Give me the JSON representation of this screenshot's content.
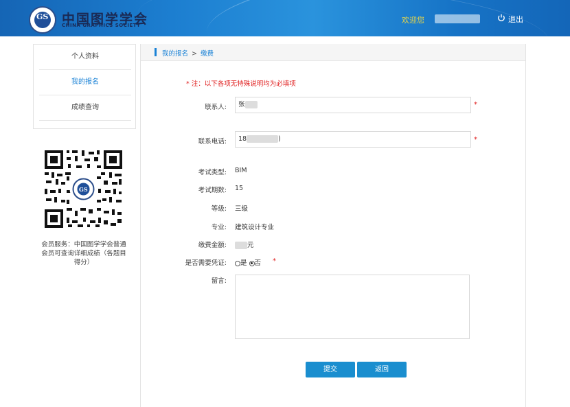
{
  "header": {
    "logo_cn": "中国图学学会",
    "logo_en": "CHINA GRAPHICS SOCIETY",
    "welcome": "欢迎您",
    "logout": "退出"
  },
  "sidebar": {
    "items": [
      {
        "label": "个人资料"
      },
      {
        "label": "我的报名"
      },
      {
        "label": "成绩查询"
      }
    ],
    "qr_caption": "会员服务：中国图学学会普通会员可查询详细成绩（各题目得分）"
  },
  "breadcrumb": {
    "parent": "我的报名",
    "separator": ">",
    "current": "缴费"
  },
  "form": {
    "note": "* 注：以下各项无特殊说明均为必填项",
    "contact_label": "联系人:",
    "contact_value": "张",
    "phone_label": "联系电话:",
    "phone_value": "18",
    "phone_suffix": ")",
    "exam_type_label": "考试类型:",
    "exam_type_value": "BIM",
    "exam_period_label": "考试期数:",
    "exam_period_value": "15",
    "level_label": "等级:",
    "level_value": "三级",
    "major_label": "专业:",
    "major_value": "建筑设计专业",
    "fee_label": "缴费金额:",
    "fee_unit": "元",
    "voucher_label": "是否需要凭证:",
    "voucher_yes": "是",
    "voucher_no": "否",
    "voucher_selected": "否",
    "message_label": "留言:",
    "required_mark": "*"
  },
  "buttons": {
    "submit": "提交",
    "back": "返回"
  },
  "colors": {
    "accent": "#1a82d6",
    "button": "#1a8ecf",
    "required": "#e02020",
    "welcome": "#e6d54a"
  }
}
